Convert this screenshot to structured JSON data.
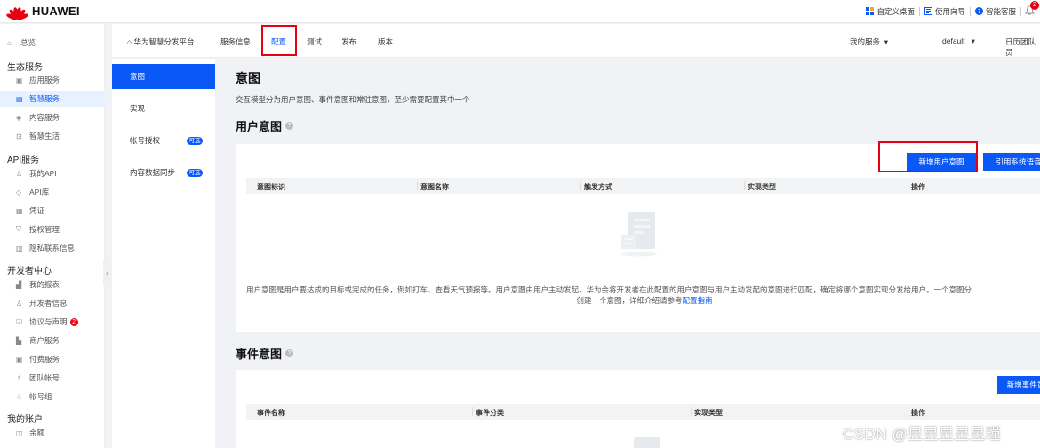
{
  "header": {
    "brand": "HUAWEI",
    "links": [
      {
        "label": "自定义桌面",
        "icon": "grid-icon"
      },
      {
        "label": "使用向导",
        "icon": "guide-icon"
      },
      {
        "label": "智能客服",
        "icon": "help-circle-icon"
      }
    ],
    "notification_count": "2"
  },
  "sidebar": {
    "home": "总览",
    "groups": [
      {
        "title": "生态服务",
        "items": [
          {
            "label": "应用服务",
            "icon": "app-icon"
          },
          {
            "label": "智慧服务",
            "icon": "smart-icon"
          },
          {
            "label": "内容服务",
            "icon": "content-icon"
          },
          {
            "label": "智慧生活",
            "icon": "life-icon"
          }
        ]
      },
      {
        "title": "API服务",
        "items": [
          {
            "label": "我的API",
            "icon": "user-icon"
          },
          {
            "label": "API库",
            "icon": "cube-icon"
          },
          {
            "label": "凭证",
            "icon": "credential-icon"
          },
          {
            "label": "授权管理",
            "icon": "shield-icon"
          },
          {
            "label": "隐私联系信息",
            "icon": "privacy-icon"
          }
        ]
      },
      {
        "title": "开发者中心",
        "items": [
          {
            "label": "我的报表",
            "icon": "chart-icon"
          },
          {
            "label": "开发者信息",
            "icon": "user-icon"
          },
          {
            "label": "协议与声明",
            "icon": "agreement-icon",
            "badge": "2"
          },
          {
            "label": "商户服务",
            "icon": "merchant-icon"
          },
          {
            "label": "付费服务",
            "icon": "pay-icon"
          },
          {
            "label": "团队帐号",
            "icon": "team-icon"
          },
          {
            "label": "帐号组",
            "icon": "group-icon"
          }
        ]
      },
      {
        "title": "我的账户",
        "items": [
          {
            "label": "余额",
            "icon": "balance-icon"
          }
        ]
      }
    ]
  },
  "subnav": {
    "breadcrumb": "华为智慧分发平台",
    "tabs": [
      "服务信息",
      "配置",
      "测试",
      "发布",
      "版本"
    ],
    "active_tab": "配置",
    "right": [
      "我的服务",
      "default",
      "日历团队员"
    ]
  },
  "secnav": {
    "items": [
      {
        "label": "意图"
      },
      {
        "label": "实现"
      },
      {
        "label": "帐号授权",
        "badge": "可选"
      },
      {
        "label": "内容数据同步",
        "badge": "可选"
      }
    ]
  },
  "main": {
    "title": "意图",
    "description": "交互模型分为用户意图、事件意图和常驻意图，至少需要配置其中一个",
    "user_intent": {
      "title": "用户意图",
      "buttons": [
        "新增用户意图",
        "引用系统语音"
      ],
      "columns": [
        "意图标识",
        "意图名称",
        "触发方式",
        "实现类型",
        "操作"
      ],
      "empty_text": "用户意图是用户要达成的目标或完成的任务，例如打车、查看天气预报等。用户意图由用户主动发起，华为会将开发者在此配置的用户意图与用户主动发起的意图进行匹配，确定将哪个意图实现分发给用户。一个意图分",
      "empty_text2": "创建一个意图，详细介绍请参考",
      "empty_link": "配置指南"
    },
    "event_intent": {
      "title": "事件意图",
      "buttons": [
        "新增事件意"
      ],
      "columns": [
        "事件名称",
        "事件分类",
        "实现类型",
        "操作"
      ]
    }
  },
  "watermark": "CSDN @昱昱昱昱昱瑾"
}
